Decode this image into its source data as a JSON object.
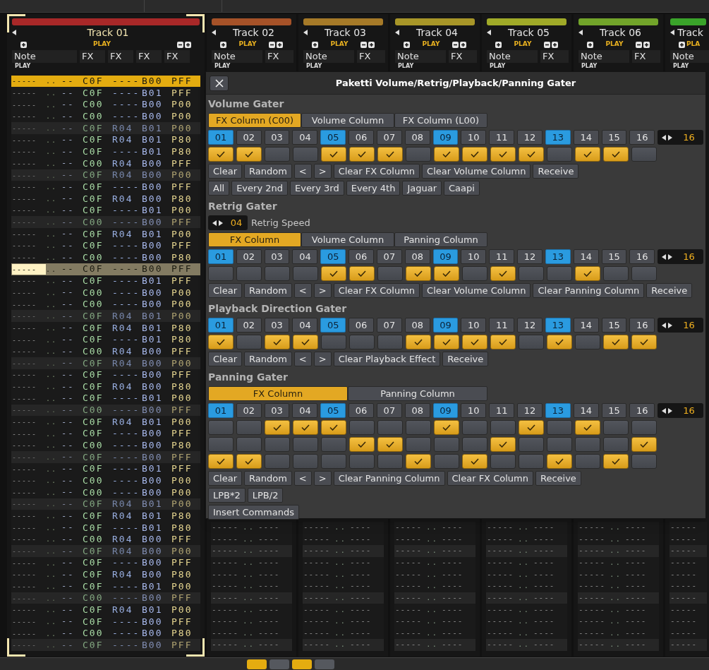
{
  "tracks": [
    {
      "name": "Track 01",
      "color": "#a82828",
      "selected": true,
      "kind": "wide",
      "play": "PLAY",
      "column_labels": [
        "Note",
        "FX",
        "FX",
        "FX",
        "FX"
      ],
      "sub": "PLAY",
      "pattern_lines": [
        {
          "kind": "selected",
          "cells": [
            "-----",
            "..",
            "--",
            "C0F",
            "----",
            "B00",
            "PFF"
          ]
        },
        {
          "kind": "normal",
          "cells": [
            "-----",
            "..",
            "--",
            "C0F",
            "----",
            "B01",
            "PFF"
          ]
        },
        {
          "kind": "normal",
          "cells": [
            "-----",
            "..",
            "--",
            "C00",
            "----",
            "B00",
            "P00"
          ]
        },
        {
          "kind": "normal",
          "cells": [
            "-----",
            "..",
            "--",
            "C00",
            "----",
            "B00",
            "P00"
          ]
        },
        {
          "kind": "beat",
          "cells": [
            "-----",
            "..",
            "--",
            "C0F",
            "R04",
            "B01",
            "P00"
          ]
        },
        {
          "kind": "normal",
          "cells": [
            "-----",
            "..",
            "--",
            "C0F",
            "R04",
            "B01",
            "P80"
          ]
        },
        {
          "kind": "normal",
          "cells": [
            "-----",
            "..",
            "--",
            "C0F",
            "----",
            "B01",
            "P80"
          ]
        },
        {
          "kind": "normal",
          "cells": [
            "-----",
            "..",
            "--",
            "C00",
            "R04",
            "B00",
            "PFF"
          ]
        },
        {
          "kind": "beat",
          "cells": [
            "-----",
            "..",
            "--",
            "C0F",
            "R04",
            "B00",
            "P00"
          ]
        },
        {
          "kind": "normal",
          "cells": [
            "-----",
            "..",
            "--",
            "C0F",
            "----",
            "B00",
            "PFF"
          ]
        },
        {
          "kind": "normal",
          "cells": [
            "-----",
            "..",
            "--",
            "C0F",
            "R04",
            "B00",
            "P80"
          ]
        },
        {
          "kind": "normal",
          "cells": [
            "-----",
            "..",
            "--",
            "C0F",
            "----",
            "B01",
            "P00"
          ]
        },
        {
          "kind": "beat",
          "cells": [
            "-----",
            "..",
            "--",
            "C00",
            "----",
            "B00",
            "PFF"
          ]
        },
        {
          "kind": "normal",
          "cells": [
            "-----",
            "..",
            "--",
            "C0F",
            "R04",
            "B01",
            "P00"
          ]
        },
        {
          "kind": "normal",
          "cells": [
            "-----",
            "..",
            "--",
            "C0F",
            "----",
            "B00",
            "PFF"
          ]
        },
        {
          "kind": "normal",
          "cells": [
            "-----",
            "..",
            "--",
            "C00",
            "----",
            "B00",
            "P80"
          ]
        },
        {
          "kind": "cursor",
          "cells": [
            "-----",
            "..",
            "--",
            "C0F",
            "----",
            "B00",
            "PFF"
          ]
        },
        {
          "kind": "normal",
          "cells": [
            "-----",
            "..",
            "--",
            "C0F",
            "----",
            "B01",
            "PFF"
          ]
        },
        {
          "kind": "normal",
          "cells": [
            "-----",
            "..",
            "--",
            "C00",
            "----",
            "B00",
            "P00"
          ]
        },
        {
          "kind": "normal",
          "cells": [
            "-----",
            "..",
            "--",
            "C00",
            "----",
            "B00",
            "P00"
          ]
        },
        {
          "kind": "beat",
          "cells": [
            "-----",
            "..",
            "--",
            "C0F",
            "R04",
            "B01",
            "P00"
          ]
        },
        {
          "kind": "normal",
          "cells": [
            "-----",
            "..",
            "--",
            "C0F",
            "R04",
            "B01",
            "P80"
          ]
        },
        {
          "kind": "normal",
          "cells": [
            "-----",
            "..",
            "--",
            "C0F",
            "----",
            "B01",
            "P80"
          ]
        },
        {
          "kind": "normal",
          "cells": [
            "-----",
            "..",
            "--",
            "C00",
            "R04",
            "B00",
            "PFF"
          ]
        },
        {
          "kind": "beat",
          "cells": [
            "-----",
            "..",
            "--",
            "C0F",
            "R04",
            "B00",
            "P00"
          ]
        },
        {
          "kind": "normal",
          "cells": [
            "-----",
            "..",
            "--",
            "C0F",
            "----",
            "B00",
            "PFF"
          ]
        },
        {
          "kind": "normal",
          "cells": [
            "-----",
            "..",
            "--",
            "C0F",
            "R04",
            "B00",
            "P80"
          ]
        },
        {
          "kind": "normal",
          "cells": [
            "-----",
            "..",
            "--",
            "C0F",
            "----",
            "B01",
            "P00"
          ]
        },
        {
          "kind": "beat",
          "cells": [
            "-----",
            "..",
            "--",
            "C00",
            "----",
            "B00",
            "PFF"
          ]
        },
        {
          "kind": "normal",
          "cells": [
            "-----",
            "..",
            "--",
            "C0F",
            "R04",
            "B01",
            "P00"
          ]
        },
        {
          "kind": "normal",
          "cells": [
            "-----",
            "..",
            "--",
            "C0F",
            "----",
            "B00",
            "PFF"
          ]
        },
        {
          "kind": "normal",
          "cells": [
            "-----",
            "..",
            "--",
            "C00",
            "----",
            "B00",
            "P80"
          ]
        },
        {
          "kind": "beat",
          "cells": [
            "-----",
            "..",
            "--",
            "C0F",
            "----",
            "B00",
            "PFF"
          ]
        },
        {
          "kind": "normal",
          "cells": [
            "-----",
            "..",
            "--",
            "C0F",
            "----",
            "B01",
            "PFF"
          ]
        },
        {
          "kind": "normal",
          "cells": [
            "-----",
            "..",
            "--",
            "C00",
            "----",
            "B00",
            "P00"
          ]
        },
        {
          "kind": "normal",
          "cells": [
            "-----",
            "..",
            "--",
            "C00",
            "----",
            "B00",
            "P00"
          ]
        },
        {
          "kind": "beat",
          "cells": [
            "-----",
            "..",
            "--",
            "C0F",
            "R04",
            "B01",
            "P00"
          ]
        },
        {
          "kind": "normal",
          "cells": [
            "-----",
            "..",
            "--",
            "C0F",
            "R04",
            "B01",
            "P80"
          ]
        },
        {
          "kind": "normal",
          "cells": [
            "-----",
            "..",
            "--",
            "C0F",
            "----",
            "B01",
            "P80"
          ]
        },
        {
          "kind": "normal",
          "cells": [
            "-----",
            "..",
            "--",
            "C00",
            "R04",
            "B00",
            "PFF"
          ]
        },
        {
          "kind": "beat",
          "cells": [
            "-----",
            "..",
            "--",
            "C0F",
            "R04",
            "B00",
            "P00"
          ]
        },
        {
          "kind": "normal",
          "cells": [
            "-----",
            "..",
            "--",
            "C0F",
            "----",
            "B00",
            "PFF"
          ]
        },
        {
          "kind": "normal",
          "cells": [
            "-----",
            "..",
            "--",
            "C0F",
            "R04",
            "B00",
            "P80"
          ]
        },
        {
          "kind": "normal",
          "cells": [
            "-----",
            "..",
            "--",
            "C0F",
            "----",
            "B01",
            "P00"
          ]
        },
        {
          "kind": "beat",
          "cells": [
            "-----",
            "..",
            "--",
            "C00",
            "----",
            "B00",
            "PFF"
          ]
        },
        {
          "kind": "normal",
          "cells": [
            "-----",
            "..",
            "--",
            "C0F",
            "R04",
            "B01",
            "P00"
          ]
        },
        {
          "kind": "normal",
          "cells": [
            "-----",
            "..",
            "--",
            "C0F",
            "----",
            "B00",
            "PFF"
          ]
        },
        {
          "kind": "normal",
          "cells": [
            "-----",
            "..",
            "--",
            "C00",
            "----",
            "B00",
            "P80"
          ]
        },
        {
          "kind": "beat",
          "cells": [
            "-----",
            "..",
            "--",
            "C0F",
            "----",
            "B00",
            "PFF"
          ]
        }
      ]
    },
    {
      "name": "Track 02",
      "color": "#a65228",
      "selected": false,
      "kind": "narrow",
      "play": "PLAY",
      "column_labels": [
        "Note",
        "FX"
      ],
      "sub": "PLAY",
      "pattern_lines": [
        {
          "kind": "normal",
          "cells": [
            "-----",
            "..",
            "----"
          ]
        },
        {
          "kind": "normal",
          "cells": [
            "-----",
            "..",
            "----"
          ]
        },
        {
          "kind": "beat",
          "cells": [
            "-----",
            "..",
            "----"
          ]
        },
        {
          "kind": "normal",
          "cells": [
            "-----",
            "..",
            "----"
          ]
        },
        {
          "kind": "normal",
          "cells": [
            "-----",
            "..",
            "----"
          ]
        },
        {
          "kind": "normal",
          "cells": [
            "-----",
            "..",
            "----"
          ]
        },
        {
          "kind": "beat",
          "cells": [
            "-----",
            "..",
            "----"
          ]
        },
        {
          "kind": "normal",
          "cells": [
            "-----",
            "..",
            "----"
          ]
        },
        {
          "kind": "normal",
          "cells": [
            "-----",
            "..",
            "----"
          ]
        },
        {
          "kind": "normal",
          "cells": [
            "-----",
            "..",
            "----"
          ]
        },
        {
          "kind": "beat",
          "cells": [
            "-----",
            "..",
            "----"
          ]
        }
      ]
    },
    {
      "name": "Track 03",
      "color": "#a67a28",
      "selected": false,
      "kind": "narrow",
      "play": "PLAY",
      "column_labels": [
        "Note",
        "FX"
      ],
      "sub": "PLAY",
      "pattern_lines": [
        {
          "kind": "normal",
          "cells": [
            "-----",
            "..",
            "----"
          ]
        },
        {
          "kind": "normal",
          "cells": [
            "-----",
            "..",
            "----"
          ]
        },
        {
          "kind": "beat",
          "cells": [
            "-----",
            "..",
            "----"
          ]
        },
        {
          "kind": "normal",
          "cells": [
            "-----",
            "..",
            "----"
          ]
        },
        {
          "kind": "normal",
          "cells": [
            "-----",
            "..",
            "----"
          ]
        },
        {
          "kind": "normal",
          "cells": [
            "-----",
            "..",
            "----"
          ]
        },
        {
          "kind": "beat",
          "cells": [
            "-----",
            "..",
            "----"
          ]
        },
        {
          "kind": "normal",
          "cells": [
            "-----",
            "..",
            "----"
          ]
        },
        {
          "kind": "normal",
          "cells": [
            "-----",
            "..",
            "----"
          ]
        },
        {
          "kind": "normal",
          "cells": [
            "-----",
            "..",
            "----"
          ]
        },
        {
          "kind": "beat",
          "cells": [
            "-----",
            "..",
            "----"
          ]
        }
      ]
    },
    {
      "name": "Track 04",
      "color": "#a89628",
      "selected": false,
      "kind": "narrow",
      "play": "PLAY",
      "column_labels": [
        "Note",
        "FX"
      ],
      "sub": "PLAY",
      "pattern_lines": [
        {
          "kind": "normal",
          "cells": [
            "-----",
            "..",
            "----"
          ]
        },
        {
          "kind": "normal",
          "cells": [
            "-----",
            "..",
            "----"
          ]
        },
        {
          "kind": "beat",
          "cells": [
            "-----",
            "..",
            "----"
          ]
        },
        {
          "kind": "normal",
          "cells": [
            "-----",
            "..",
            "----"
          ]
        },
        {
          "kind": "normal",
          "cells": [
            "-----",
            "..",
            "----"
          ]
        },
        {
          "kind": "normal",
          "cells": [
            "-----",
            "..",
            "----"
          ]
        },
        {
          "kind": "beat",
          "cells": [
            "-----",
            "..",
            "----"
          ]
        },
        {
          "kind": "normal",
          "cells": [
            "-----",
            "..",
            "----"
          ]
        },
        {
          "kind": "normal",
          "cells": [
            "-----",
            "..",
            "----"
          ]
        },
        {
          "kind": "normal",
          "cells": [
            "-----",
            "..",
            "----"
          ]
        },
        {
          "kind": "beat",
          "cells": [
            "-----",
            "..",
            "----"
          ]
        }
      ]
    },
    {
      "name": "Track 05",
      "color": "#a0aa28",
      "selected": false,
      "kind": "narrow",
      "play": "PLAY",
      "column_labels": [
        "Note",
        "FX"
      ],
      "sub": "PLAY",
      "pattern_lines": [
        {
          "kind": "normal",
          "cells": [
            "-----",
            "..",
            "----"
          ]
        },
        {
          "kind": "normal",
          "cells": [
            "-----",
            "..",
            "----"
          ]
        },
        {
          "kind": "beat",
          "cells": [
            "-----",
            "..",
            "----"
          ]
        },
        {
          "kind": "normal",
          "cells": [
            "-----",
            "..",
            "----"
          ]
        },
        {
          "kind": "normal",
          "cells": [
            "-----",
            "..",
            "----"
          ]
        },
        {
          "kind": "normal",
          "cells": [
            "-----",
            "..",
            "----"
          ]
        },
        {
          "kind": "beat",
          "cells": [
            "-----",
            "..",
            "----"
          ]
        },
        {
          "kind": "normal",
          "cells": [
            "-----",
            "..",
            "----"
          ]
        },
        {
          "kind": "normal",
          "cells": [
            "-----",
            "..",
            "----"
          ]
        },
        {
          "kind": "normal",
          "cells": [
            "-----",
            "..",
            "----"
          ]
        },
        {
          "kind": "beat",
          "cells": [
            "-----",
            "..",
            "----"
          ]
        }
      ]
    },
    {
      "name": "Track 06",
      "color": "#72a42a",
      "selected": false,
      "kind": "narrow",
      "play": "PLAY",
      "column_labels": [
        "Note",
        "FX"
      ],
      "sub": "PLAY",
      "pattern_lines": [
        {
          "kind": "normal",
          "cells": [
            "-----",
            "..",
            "----"
          ]
        },
        {
          "kind": "normal",
          "cells": [
            "-----",
            "..",
            "----"
          ]
        },
        {
          "kind": "beat",
          "cells": [
            "-----",
            "..",
            "----"
          ]
        },
        {
          "kind": "normal",
          "cells": [
            "-----",
            "..",
            "----"
          ]
        },
        {
          "kind": "normal",
          "cells": [
            "-----",
            "..",
            "----"
          ]
        },
        {
          "kind": "normal",
          "cells": [
            "-----",
            "..",
            "----"
          ]
        },
        {
          "kind": "beat",
          "cells": [
            "-----",
            "..",
            "----"
          ]
        },
        {
          "kind": "normal",
          "cells": [
            "-----",
            "..",
            "----"
          ]
        },
        {
          "kind": "normal",
          "cells": [
            "-----",
            "..",
            "----"
          ]
        },
        {
          "kind": "normal",
          "cells": [
            "-----",
            "..",
            "----"
          ]
        },
        {
          "kind": "beat",
          "cells": [
            "-----",
            "..",
            "----"
          ]
        }
      ]
    },
    {
      "name": "Track",
      "color": "#3aa42a",
      "selected": false,
      "kind": "cut",
      "play": "PLA",
      "column_labels": [
        "Note"
      ],
      "sub": "PLAY",
      "pattern_lines": [
        {
          "kind": "normal",
          "cells": [
            "-----"
          ]
        },
        {
          "kind": "normal",
          "cells": [
            "-----"
          ]
        },
        {
          "kind": "beat",
          "cells": [
            "-----"
          ]
        },
        {
          "kind": "normal",
          "cells": [
            "-----"
          ]
        },
        {
          "kind": "normal",
          "cells": [
            "-----"
          ]
        },
        {
          "kind": "normal",
          "cells": [
            "-----"
          ]
        },
        {
          "kind": "beat",
          "cells": [
            "-----"
          ]
        },
        {
          "kind": "normal",
          "cells": [
            "-----"
          ]
        },
        {
          "kind": "normal",
          "cells": [
            "-----"
          ]
        },
        {
          "kind": "normal",
          "cells": [
            "-----"
          ]
        },
        {
          "kind": "beat",
          "cells": [
            "-----"
          ]
        }
      ]
    }
  ],
  "dialog": {
    "title": "Paketti Volume/Retrig/Playback/Panning Gater",
    "sections": [
      {
        "title": "Volume Gater",
        "modes": [
          {
            "label": "FX Column (C00)",
            "selected": true
          },
          {
            "label": "Volume Column",
            "selected": false
          },
          {
            "label": "FX Column (L00)",
            "selected": false
          }
        ],
        "steps": [
          {
            "label": "01",
            "highlight": true
          },
          {
            "label": "02",
            "highlight": false
          },
          {
            "label": "03",
            "highlight": false
          },
          {
            "label": "04",
            "highlight": false
          },
          {
            "label": "05",
            "highlight": true
          },
          {
            "label": "06",
            "highlight": false
          },
          {
            "label": "07",
            "highlight": false
          },
          {
            "label": "08",
            "highlight": false
          },
          {
            "label": "09",
            "highlight": true
          },
          {
            "label": "10",
            "highlight": false
          },
          {
            "label": "11",
            "highlight": false
          },
          {
            "label": "12",
            "highlight": false
          },
          {
            "label": "13",
            "highlight": true
          },
          {
            "label": "14",
            "highlight": false
          },
          {
            "label": "15",
            "highlight": false
          },
          {
            "label": "16",
            "highlight": false
          }
        ],
        "step_count": "16",
        "gates": [
          {
            "checked": [
              true,
              true,
              false,
              false,
              true,
              true,
              true,
              false,
              true,
              true,
              true,
              true,
              false,
              true,
              true,
              false
            ]
          }
        ],
        "button_rows": [
          [
            "Clear",
            "Random",
            "<",
            ">",
            "Clear FX Column",
            "Clear Volume Column",
            "Receive"
          ],
          [
            "All",
            "Every 2nd",
            "Every 3rd",
            "Every 4th",
            "Jaguar",
            "Caapi"
          ]
        ]
      },
      {
        "title": "Retrig Gater",
        "speed": {
          "value": "04",
          "label": "Retrig Speed"
        },
        "modes": [
          {
            "label": "FX Column",
            "selected": true
          },
          {
            "label": "Volume Column",
            "selected": false
          },
          {
            "label": "Panning Column",
            "selected": false
          }
        ],
        "steps": [
          {
            "label": "01",
            "highlight": true
          },
          {
            "label": "02",
            "highlight": false
          },
          {
            "label": "03",
            "highlight": false
          },
          {
            "label": "04",
            "highlight": false
          },
          {
            "label": "05",
            "highlight": true
          },
          {
            "label": "06",
            "highlight": false
          },
          {
            "label": "07",
            "highlight": false
          },
          {
            "label": "08",
            "highlight": false
          },
          {
            "label": "09",
            "highlight": true
          },
          {
            "label": "10",
            "highlight": false
          },
          {
            "label": "11",
            "highlight": false
          },
          {
            "label": "12",
            "highlight": false
          },
          {
            "label": "13",
            "highlight": true
          },
          {
            "label": "14",
            "highlight": false
          },
          {
            "label": "15",
            "highlight": false
          },
          {
            "label": "16",
            "highlight": false
          }
        ],
        "step_count": "16",
        "gates": [
          {
            "checked": [
              false,
              false,
              false,
              false,
              true,
              true,
              false,
              true,
              true,
              false,
              true,
              false,
              false,
              true,
              false,
              false
            ]
          }
        ],
        "button_rows": [
          [
            "Clear",
            "Random",
            "<",
            ">",
            "Clear FX Column",
            "Clear Volume Column",
            "Clear Panning Column",
            "Receive"
          ]
        ]
      },
      {
        "title": "Playback Direction Gater",
        "steps": [
          {
            "label": "01",
            "highlight": true
          },
          {
            "label": "02",
            "highlight": false
          },
          {
            "label": "03",
            "highlight": false
          },
          {
            "label": "04",
            "highlight": false
          },
          {
            "label": "05",
            "highlight": true
          },
          {
            "label": "06",
            "highlight": false
          },
          {
            "label": "07",
            "highlight": false
          },
          {
            "label": "08",
            "highlight": false
          },
          {
            "label": "09",
            "highlight": true
          },
          {
            "label": "10",
            "highlight": false
          },
          {
            "label": "11",
            "highlight": false
          },
          {
            "label": "12",
            "highlight": false
          },
          {
            "label": "13",
            "highlight": true
          },
          {
            "label": "14",
            "highlight": false
          },
          {
            "label": "15",
            "highlight": false
          },
          {
            "label": "16",
            "highlight": false
          }
        ],
        "step_count": "16",
        "gates": [
          {
            "checked": [
              true,
              false,
              true,
              true,
              false,
              false,
              false,
              true,
              true,
              true,
              true,
              false,
              true,
              false,
              true,
              true
            ]
          }
        ],
        "button_rows": [
          [
            "Clear",
            "Random",
            "<",
            ">",
            "Clear Playback Effect",
            "Receive"
          ]
        ]
      },
      {
        "title": "Panning Gater",
        "modes": [
          {
            "label": "FX Column",
            "selected": true
          },
          {
            "label": "Panning Column",
            "selected": false
          }
        ],
        "steps": [
          {
            "label": "01",
            "highlight": true
          },
          {
            "label": "02",
            "highlight": false
          },
          {
            "label": "03",
            "highlight": false
          },
          {
            "label": "04",
            "highlight": false
          },
          {
            "label": "05",
            "highlight": true
          },
          {
            "label": "06",
            "highlight": false
          },
          {
            "label": "07",
            "highlight": false
          },
          {
            "label": "08",
            "highlight": false
          },
          {
            "label": "09",
            "highlight": true
          },
          {
            "label": "10",
            "highlight": false
          },
          {
            "label": "11",
            "highlight": false
          },
          {
            "label": "12",
            "highlight": false
          },
          {
            "label": "13",
            "highlight": true
          },
          {
            "label": "14",
            "highlight": false
          },
          {
            "label": "15",
            "highlight": false
          },
          {
            "label": "16",
            "highlight": false
          }
        ],
        "step_count": "16",
        "gates": [
          {
            "checked": [
              false,
              false,
              true,
              true,
              true,
              false,
              false,
              false,
              true,
              false,
              false,
              true,
              false,
              true,
              false,
              false
            ]
          },
          {
            "checked": [
              false,
              false,
              false,
              false,
              false,
              true,
              true,
              false,
              false,
              false,
              true,
              false,
              false,
              false,
              false,
              true
            ]
          },
          {
            "checked": [
              true,
              true,
              false,
              false,
              false,
              false,
              false,
              true,
              false,
              true,
              false,
              false,
              true,
              false,
              true,
              false
            ]
          }
        ],
        "button_rows": [
          [
            "Clear",
            "Random",
            "<",
            ">",
            "Clear Panning Column",
            "Clear FX Column",
            "Receive"
          ],
          [
            "LPB*2",
            "LPB/2"
          ],
          [
            "Insert Commands"
          ]
        ]
      }
    ]
  },
  "toolbar_toggles": [
    {
      "on": true
    },
    {
      "on": false
    },
    {
      "on": true
    },
    {
      "on": false
    }
  ]
}
